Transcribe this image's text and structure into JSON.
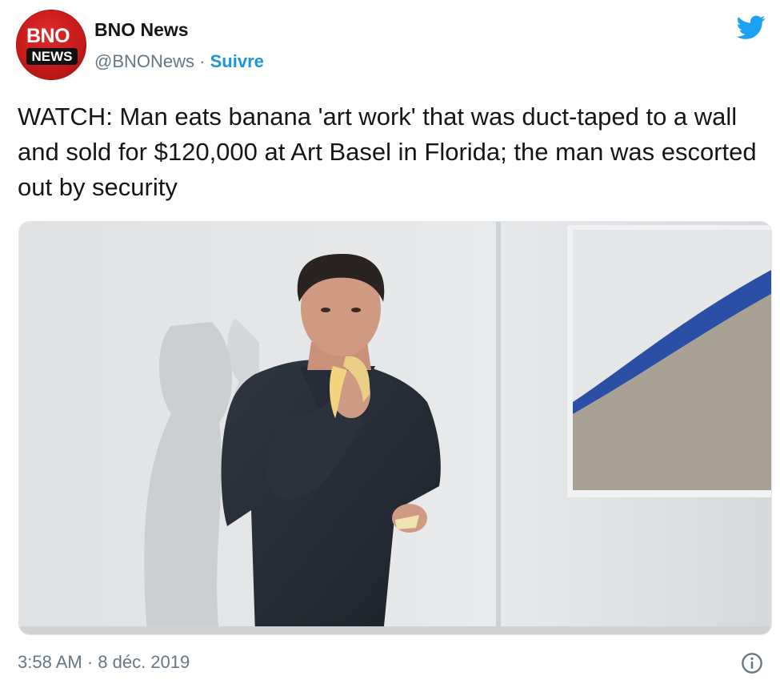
{
  "author": {
    "display_name": "BNO News",
    "handle": "@BNONews",
    "separator": "·",
    "follow_label": "Suivre",
    "avatar_top": "BNO",
    "avatar_bottom": "NEWS"
  },
  "tweet": {
    "text": "WATCH: Man eats banana 'art work' that was duct-taped to a wall and sold for $120,000 at Art Basel in Florida; the man was escorted out by security"
  },
  "meta": {
    "timestamp": "3:58 AM · 8 déc. 2019"
  },
  "icons": {
    "brand": "twitter-bird-icon",
    "info": "info-icon"
  },
  "colors": {
    "accent": "#1b95e0",
    "avatar_red": "#c21a1a",
    "secondary_text": "#657786"
  }
}
